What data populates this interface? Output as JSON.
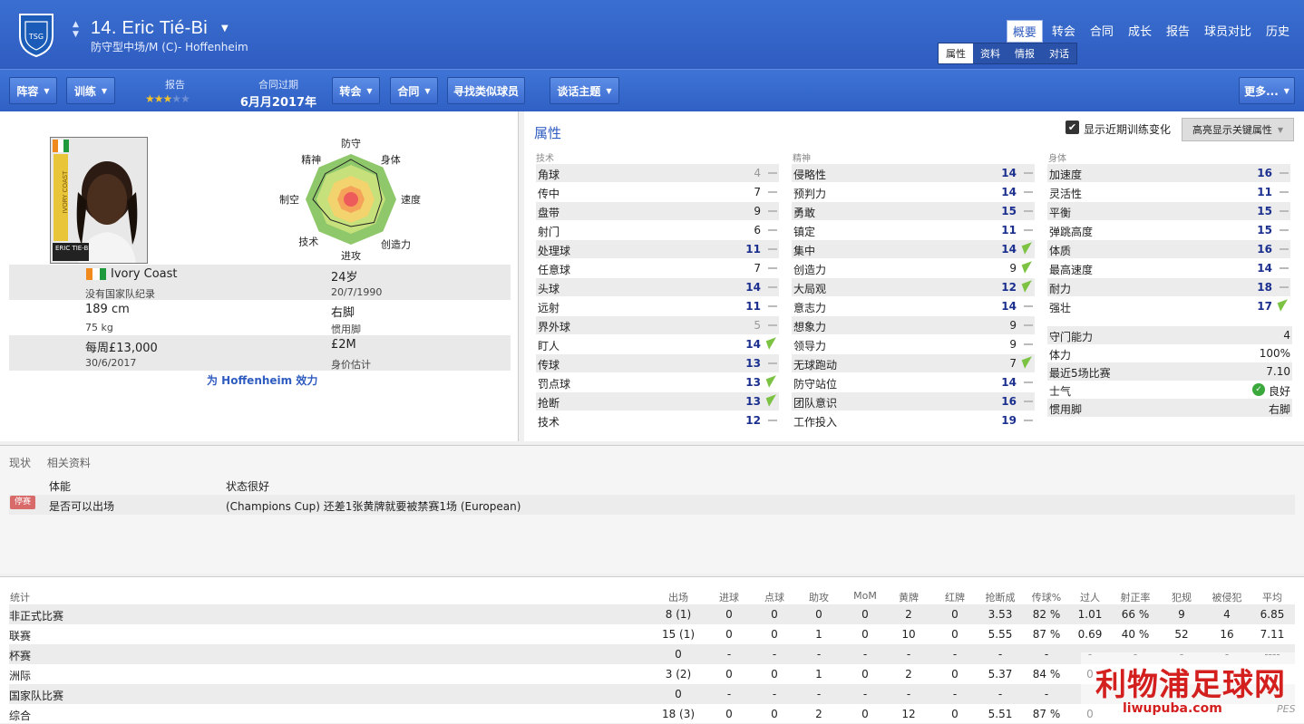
{
  "header": {
    "title": "14. Eric Tié-Bi",
    "subtitle": "防守型中场/M (C)- Hoffenheim",
    "nav": [
      "概要",
      "转会",
      "合同",
      "成长",
      "报告",
      "球员对比",
      "历史"
    ],
    "nav_active": "概要",
    "subnav": [
      "属性",
      "资料",
      "情报",
      "对话"
    ],
    "subnav_active": "属性"
  },
  "toolbar": {
    "squad": "阵容",
    "training": "训练",
    "report_label": "报告",
    "report_stars": 3,
    "contract_label": "合同过期",
    "contract_value": "6月月2017年",
    "transfer": "转会",
    "contract": "合同",
    "find_similar": "寻找类似球员",
    "talk": "谈话主题",
    "more": "更多..."
  },
  "profile": {
    "card_text": "ERIC TIE-BI",
    "card_side": "IVORY COAST",
    "nation": "Ivory Coast",
    "age": "24岁",
    "caps": "没有国家队纪录",
    "dob": "20/7/1990",
    "height": "189 cm",
    "foot": "右脚",
    "weight": "75 kg",
    "foot_label": "惯用脚",
    "wage": "每周£13,000",
    "value": "£2M",
    "contract_end": "30/6/2017",
    "value_label": "身价估计",
    "plays_for": "为 Hoffenheim 效力"
  },
  "radar": {
    "labels": [
      "防守",
      "身体",
      "速度",
      "创造力",
      "进攻",
      "技术",
      "制空",
      "精神"
    ]
  },
  "attributes": {
    "title": "属性",
    "show_training": "显示近期训练变化",
    "highlight_btn": "高亮显示关键属性",
    "technical_title": "技术",
    "mental_title": "精神",
    "physical_title": "身体",
    "technical": [
      {
        "n": "角球",
        "v": "4",
        "s": "grey",
        "t": "dash"
      },
      {
        "n": "传中",
        "v": "7",
        "s": "norm",
        "t": "dash"
      },
      {
        "n": "盘带",
        "v": "9",
        "s": "norm",
        "t": "dash"
      },
      {
        "n": "射门",
        "v": "6",
        "s": "norm",
        "t": "dash"
      },
      {
        "n": "处理球",
        "v": "11",
        "s": "",
        "t": "dash"
      },
      {
        "n": "任意球",
        "v": "7",
        "s": "norm",
        "t": "dash"
      },
      {
        "n": "头球",
        "v": "14",
        "s": "",
        "t": "dash"
      },
      {
        "n": "远射",
        "v": "11",
        "s": "",
        "t": "dash"
      },
      {
        "n": "界外球",
        "v": "5",
        "s": "grey",
        "t": "dash"
      },
      {
        "n": "盯人",
        "v": "14",
        "s": "",
        "t": "up"
      },
      {
        "n": "传球",
        "v": "13",
        "s": "",
        "t": "dash"
      },
      {
        "n": "罚点球",
        "v": "13",
        "s": "",
        "t": "up"
      },
      {
        "n": "抢断",
        "v": "13",
        "s": "",
        "t": "up"
      },
      {
        "n": "技术",
        "v": "12",
        "s": "",
        "t": "dash"
      }
    ],
    "mental": [
      {
        "n": "侵略性",
        "v": "14",
        "s": "",
        "t": "dash"
      },
      {
        "n": "预判力",
        "v": "14",
        "s": "",
        "t": "dash"
      },
      {
        "n": "勇敢",
        "v": "15",
        "s": "",
        "t": "dash"
      },
      {
        "n": "镇定",
        "v": "11",
        "s": "",
        "t": "dash"
      },
      {
        "n": "集中",
        "v": "14",
        "s": "",
        "t": "up"
      },
      {
        "n": "创造力",
        "v": "9",
        "s": "norm",
        "t": "up"
      },
      {
        "n": "大局观",
        "v": "12",
        "s": "",
        "t": "up"
      },
      {
        "n": "意志力",
        "v": "14",
        "s": "",
        "t": "dash"
      },
      {
        "n": "想象力",
        "v": "9",
        "s": "norm",
        "t": "dash"
      },
      {
        "n": "领导力",
        "v": "9",
        "s": "norm",
        "t": "dash"
      },
      {
        "n": "无球跑动",
        "v": "7",
        "s": "norm",
        "t": "up"
      },
      {
        "n": "防守站位",
        "v": "14",
        "s": "",
        "t": "dash"
      },
      {
        "n": "团队意识",
        "v": "16",
        "s": "",
        "t": "dash"
      },
      {
        "n": "工作投入",
        "v": "19",
        "s": "",
        "t": "dash"
      }
    ],
    "physical": [
      {
        "n": "加速度",
        "v": "16",
        "s": "",
        "t": "dash"
      },
      {
        "n": "灵活性",
        "v": "11",
        "s": "",
        "t": "dash"
      },
      {
        "n": "平衡",
        "v": "15",
        "s": "",
        "t": "dash"
      },
      {
        "n": "弹跳高度",
        "v": "15",
        "s": "",
        "t": "dash"
      },
      {
        "n": "体质",
        "v": "16",
        "s": "",
        "t": "dash"
      },
      {
        "n": "最高速度",
        "v": "14",
        "s": "",
        "t": "dash"
      },
      {
        "n": "耐力",
        "v": "18",
        "s": "",
        "t": "dash"
      },
      {
        "n": "强壮",
        "v": "17",
        "s": "",
        "t": "up"
      }
    ],
    "other": [
      {
        "n": "守门能力",
        "v": "4"
      },
      {
        "n": "体力",
        "v": "100%"
      },
      {
        "n": "最近5场比赛",
        "v": "7.10"
      },
      {
        "n": "士气",
        "v": "良好"
      },
      {
        "n": "惯用脚",
        "v": "右脚"
      }
    ]
  },
  "status": {
    "tab1": "现状",
    "tab2": "相关资料",
    "r1_label": "体能",
    "r1_value": "状态很好",
    "badge": "停赛",
    "r2_label": "是否可以出场",
    "r2_value": "(Champions Cup) 还差1张黄牌就要被禁赛1场 (European)"
  },
  "stats": {
    "title": "统计",
    "headers": [
      "出场",
      "进球",
      "点球",
      "助攻",
      "MoM",
      "黄牌",
      "红牌",
      "抢断成",
      "传球%",
      "过人",
      "射正率",
      "犯规",
      "被侵犯",
      "平均"
    ],
    "rows": [
      {
        "label": "非正式比赛",
        "cells": [
          "8 (1)",
          "0",
          "0",
          "0",
          "0",
          "2",
          "0",
          "3.53",
          "82 %",
          "1.01",
          "66 %",
          "9",
          "4",
          "6.85"
        ]
      },
      {
        "label": "联赛",
        "cells": [
          "15 (1)",
          "0",
          "0",
          "1",
          "0",
          "10",
          "0",
          "5.55",
          "87 %",
          "0.69",
          "40 %",
          "52",
          "16",
          "7.11"
        ]
      },
      {
        "label": "杯赛",
        "cells": [
          "0",
          "-",
          "-",
          "-",
          "-",
          "-",
          "-",
          "-",
          "-",
          "-",
          "-",
          "-",
          "-",
          "----"
        ]
      },
      {
        "label": "洲际",
        "cells": [
          "3 (2)",
          "0",
          "0",
          "1",
          "0",
          "2",
          "0",
          "5.37",
          "84 %",
          "0",
          "",
          "",
          "",
          ""
        ]
      },
      {
        "label": "国家队比赛",
        "cells": [
          "0",
          "-",
          "-",
          "-",
          "-",
          "-",
          "-",
          "-",
          "-",
          "",
          "",
          "",
          "",
          ""
        ]
      },
      {
        "label": "综合",
        "cells": [
          "18 (3)",
          "0",
          "0",
          "2",
          "0",
          "12",
          "0",
          "5.51",
          "87 %",
          "0",
          "",
          "",
          "",
          ""
        ]
      }
    ]
  },
  "watermark": {
    "cn": "利物浦足球网",
    "url": "liwupuba.com",
    "pes": "PES"
  },
  "colors": {
    "header": "#3a6fd0",
    "attr_value": "#1b2f8f",
    "improve": "#7cc243"
  }
}
